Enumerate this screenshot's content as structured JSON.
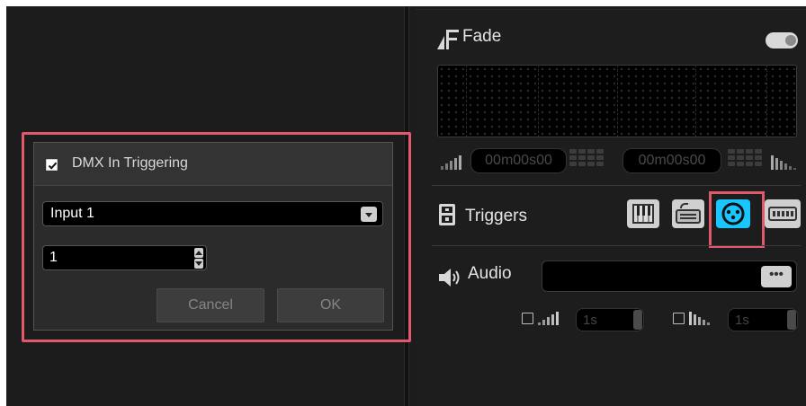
{
  "dialog": {
    "title": "DMX In Triggering",
    "enabled": true,
    "input_selected": "Input 1",
    "channel_value": "1",
    "cancel_label": "Cancel",
    "ok_label": "OK"
  },
  "fade": {
    "label": "Fade",
    "enabled": false,
    "fade_in_time": "00m00s00",
    "fade_out_time": "00m00s00"
  },
  "triggers": {
    "label": "Triggers",
    "buttons": [
      {
        "name": "midi-icon",
        "active": false
      },
      {
        "name": "keyboard-icon",
        "active": false
      },
      {
        "name": "dmx-icon",
        "active": true
      },
      {
        "name": "timecode-icon",
        "active": false
      }
    ]
  },
  "audio": {
    "label": "Audio",
    "file_value": "",
    "browse_label": "•••",
    "fade_in_enabled": false,
    "fade_in_duration": "1s",
    "fade_out_enabled": false,
    "fade_out_duration": "1s"
  },
  "colors": {
    "accent_active": "#19c6ff",
    "highlight_annotation": "#e05a6b",
    "background": "#1c1c1c"
  }
}
